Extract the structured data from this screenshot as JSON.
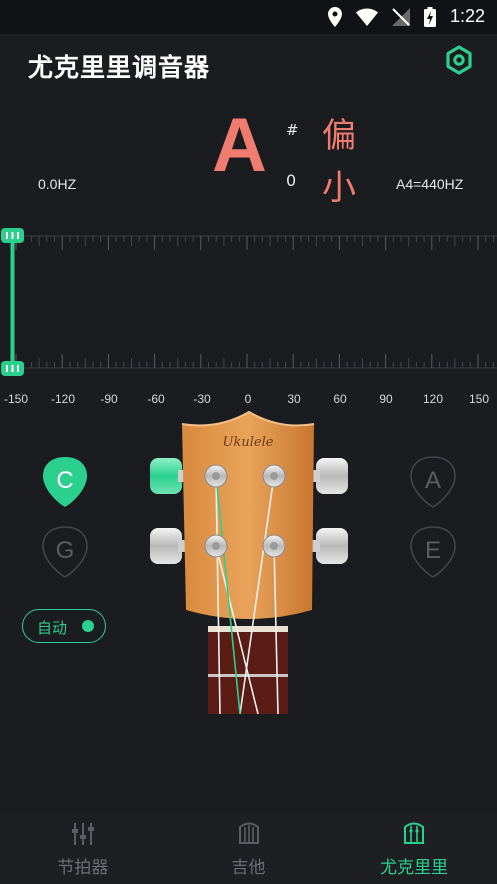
{
  "status_bar": {
    "time": "1:22"
  },
  "header": {
    "title": "尤克里里调音器"
  },
  "tuner": {
    "note": "A",
    "sharp": "#",
    "octave": "0",
    "status": "偏小",
    "current_freq": "0.0HZ",
    "reference": "A4=440HZ",
    "scale_labels": [
      "-150",
      "-120",
      "-90",
      "-60",
      "-30",
      "0",
      "30",
      "60",
      "90",
      "120",
      "150"
    ]
  },
  "strings": {
    "c": "C",
    "g": "G",
    "a": "A",
    "e": "E",
    "selected": "C"
  },
  "auto": {
    "label": "自动"
  },
  "ukulele": {
    "brand": "Ukulele"
  },
  "nav": {
    "metronome": "节拍器",
    "guitar": "吉他",
    "ukulele": "尤克里里",
    "active": "尤克里里"
  },
  "colors": {
    "accent": "#2bd08f",
    "warning": "#f07c70",
    "background": "#1b1c20"
  }
}
